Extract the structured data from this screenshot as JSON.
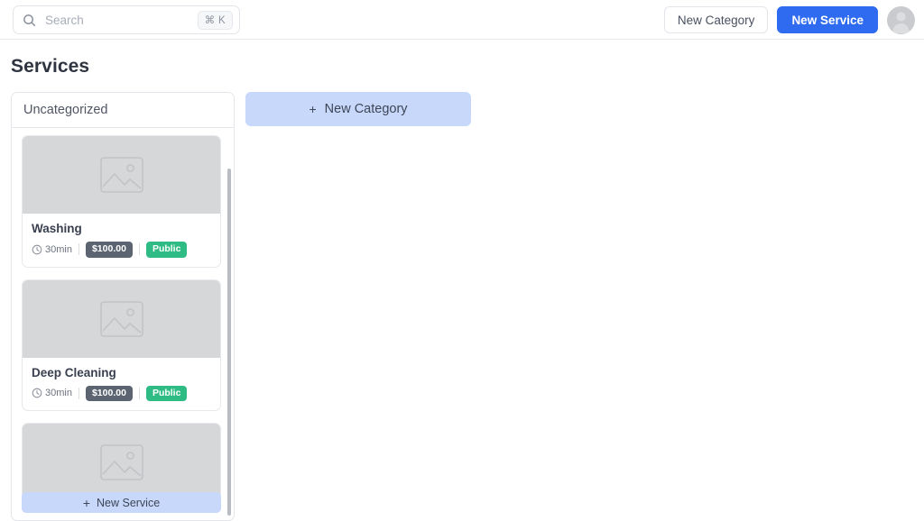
{
  "topbar": {
    "search": {
      "placeholder": "Search",
      "value": "",
      "shortcut": "⌘ K"
    },
    "new_category_label": "New Category",
    "new_service_label": "New Service"
  },
  "page": {
    "title": "Services"
  },
  "board": {
    "new_category_button": {
      "icon": "+",
      "label": "New Category"
    },
    "column": {
      "header": "Uncategorized",
      "new_service_button": {
        "icon": "+",
        "label": "New Service"
      },
      "cards": [
        {
          "title": "Washing",
          "duration": "30min",
          "price": "$100.00",
          "visibility": "Public"
        },
        {
          "title": "Deep Cleaning",
          "duration": "30min",
          "price": "$100.00",
          "visibility": "Public"
        }
      ]
    }
  },
  "colors": {
    "primary": "#2f6bf0",
    "accent_soft": "#c7d8fb",
    "price_badge": "#5c6472",
    "public_badge": "#2fbb84",
    "image_placeholder": "#d6d7d9"
  }
}
